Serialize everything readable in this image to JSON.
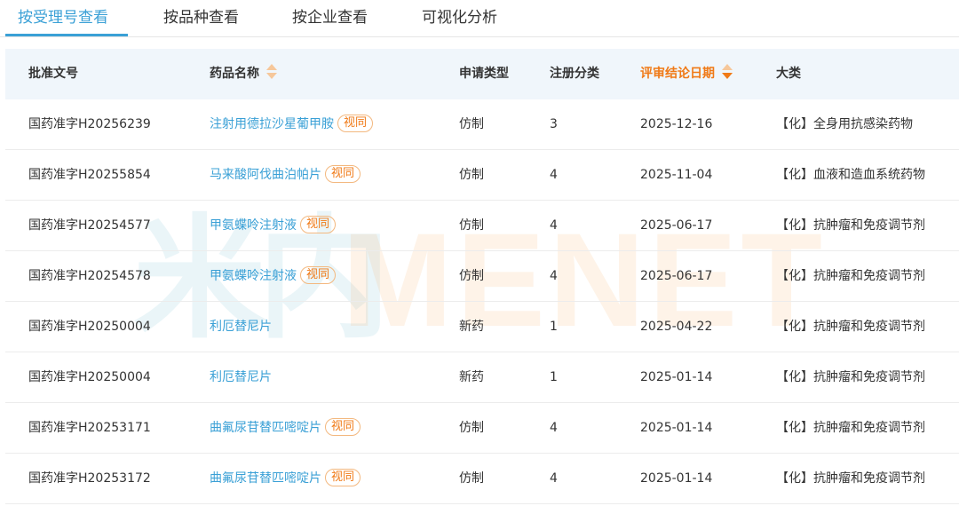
{
  "tabs": [
    {
      "label": "按受理号查看",
      "active": true
    },
    {
      "label": "按品种查看",
      "active": false
    },
    {
      "label": "按企业查看",
      "active": false
    },
    {
      "label": "可视化分析",
      "active": false
    }
  ],
  "table": {
    "headers": {
      "approval_no": "批准文号",
      "drug_name": "药品名称",
      "app_type": "申请类型",
      "reg_class": "注册分类",
      "review_date": "评审结论日期",
      "category": "大类"
    },
    "sort": {
      "column": "review_date",
      "direction": "desc"
    },
    "badge_label": "视同",
    "rows": [
      {
        "approval_no": "国药准字H20256239",
        "drug_name": "注射用德拉沙星葡甲胺",
        "badge": "视同",
        "app_type": "仿制",
        "reg_class": "3",
        "review_date": "2025-12-16",
        "category": "【化】全身用抗感染药物"
      },
      {
        "approval_no": "国药准字H20255854",
        "drug_name": "马来酸阿伐曲泊帕片",
        "badge": "视同",
        "app_type": "仿制",
        "reg_class": "4",
        "review_date": "2025-11-04",
        "category": "【化】血液和造血系统药物"
      },
      {
        "approval_no": "国药准字H20254577",
        "drug_name": "甲氨蝶呤注射液",
        "badge": "视同",
        "app_type": "仿制",
        "reg_class": "4",
        "review_date": "2025-06-17",
        "category": "【化】抗肿瘤和免疫调节剂"
      },
      {
        "approval_no": "国药准字H20254578",
        "drug_name": "甲氨蝶呤注射液",
        "badge": "视同",
        "app_type": "仿制",
        "reg_class": "4",
        "review_date": "2025-06-17",
        "category": "【化】抗肿瘤和免疫调节剂"
      },
      {
        "approval_no": "国药准字H20250004",
        "drug_name": "利厄替尼片",
        "badge": "",
        "app_type": "新药",
        "reg_class": "1",
        "review_date": "2025-04-22",
        "category": "【化】抗肿瘤和免疫调节剂"
      },
      {
        "approval_no": "国药准字H20250004",
        "drug_name": "利厄替尼片",
        "badge": "",
        "app_type": "新药",
        "reg_class": "1",
        "review_date": "2025-01-14",
        "category": "【化】抗肿瘤和免疫调节剂"
      },
      {
        "approval_no": "国药准字H20253171",
        "drug_name": "曲氟尿苷替匹嘧啶片",
        "badge": "视同",
        "app_type": "仿制",
        "reg_class": "4",
        "review_date": "2025-01-14",
        "category": "【化】抗肿瘤和免疫调节剂"
      },
      {
        "approval_no": "国药准字H20253172",
        "drug_name": "曲氟尿苷替匹嘧啶片",
        "badge": "视同",
        "app_type": "仿制",
        "reg_class": "4",
        "review_date": "2025-01-14",
        "category": "【化】抗肿瘤和免疫调节剂"
      }
    ]
  },
  "watermark": {
    "cn": "米内",
    "en": "MENET"
  },
  "colors": {
    "accent": "#3aa0d6",
    "sort_active": "#f07a17",
    "header_bg": "#f0f6fb"
  }
}
